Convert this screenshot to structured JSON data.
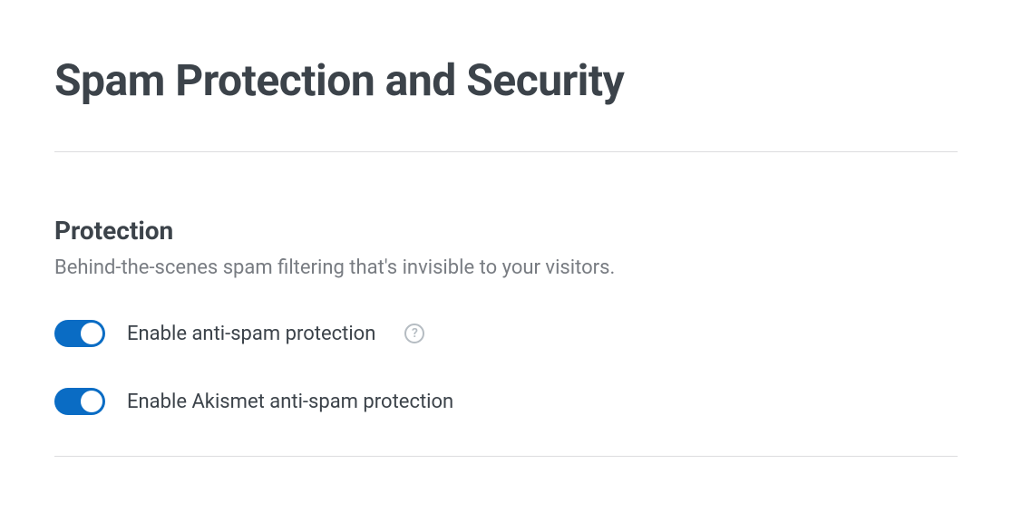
{
  "page": {
    "title": "Spam Protection and Security"
  },
  "section": {
    "title": "Protection",
    "description": "Behind-the-scenes spam filtering that's invisible to your visitors."
  },
  "toggles": {
    "antiSpam": {
      "label": "Enable anti-spam protection",
      "enabled": true
    },
    "akismet": {
      "label": "Enable Akismet anti-spam protection",
      "enabled": true
    }
  },
  "helpIcon": "?"
}
